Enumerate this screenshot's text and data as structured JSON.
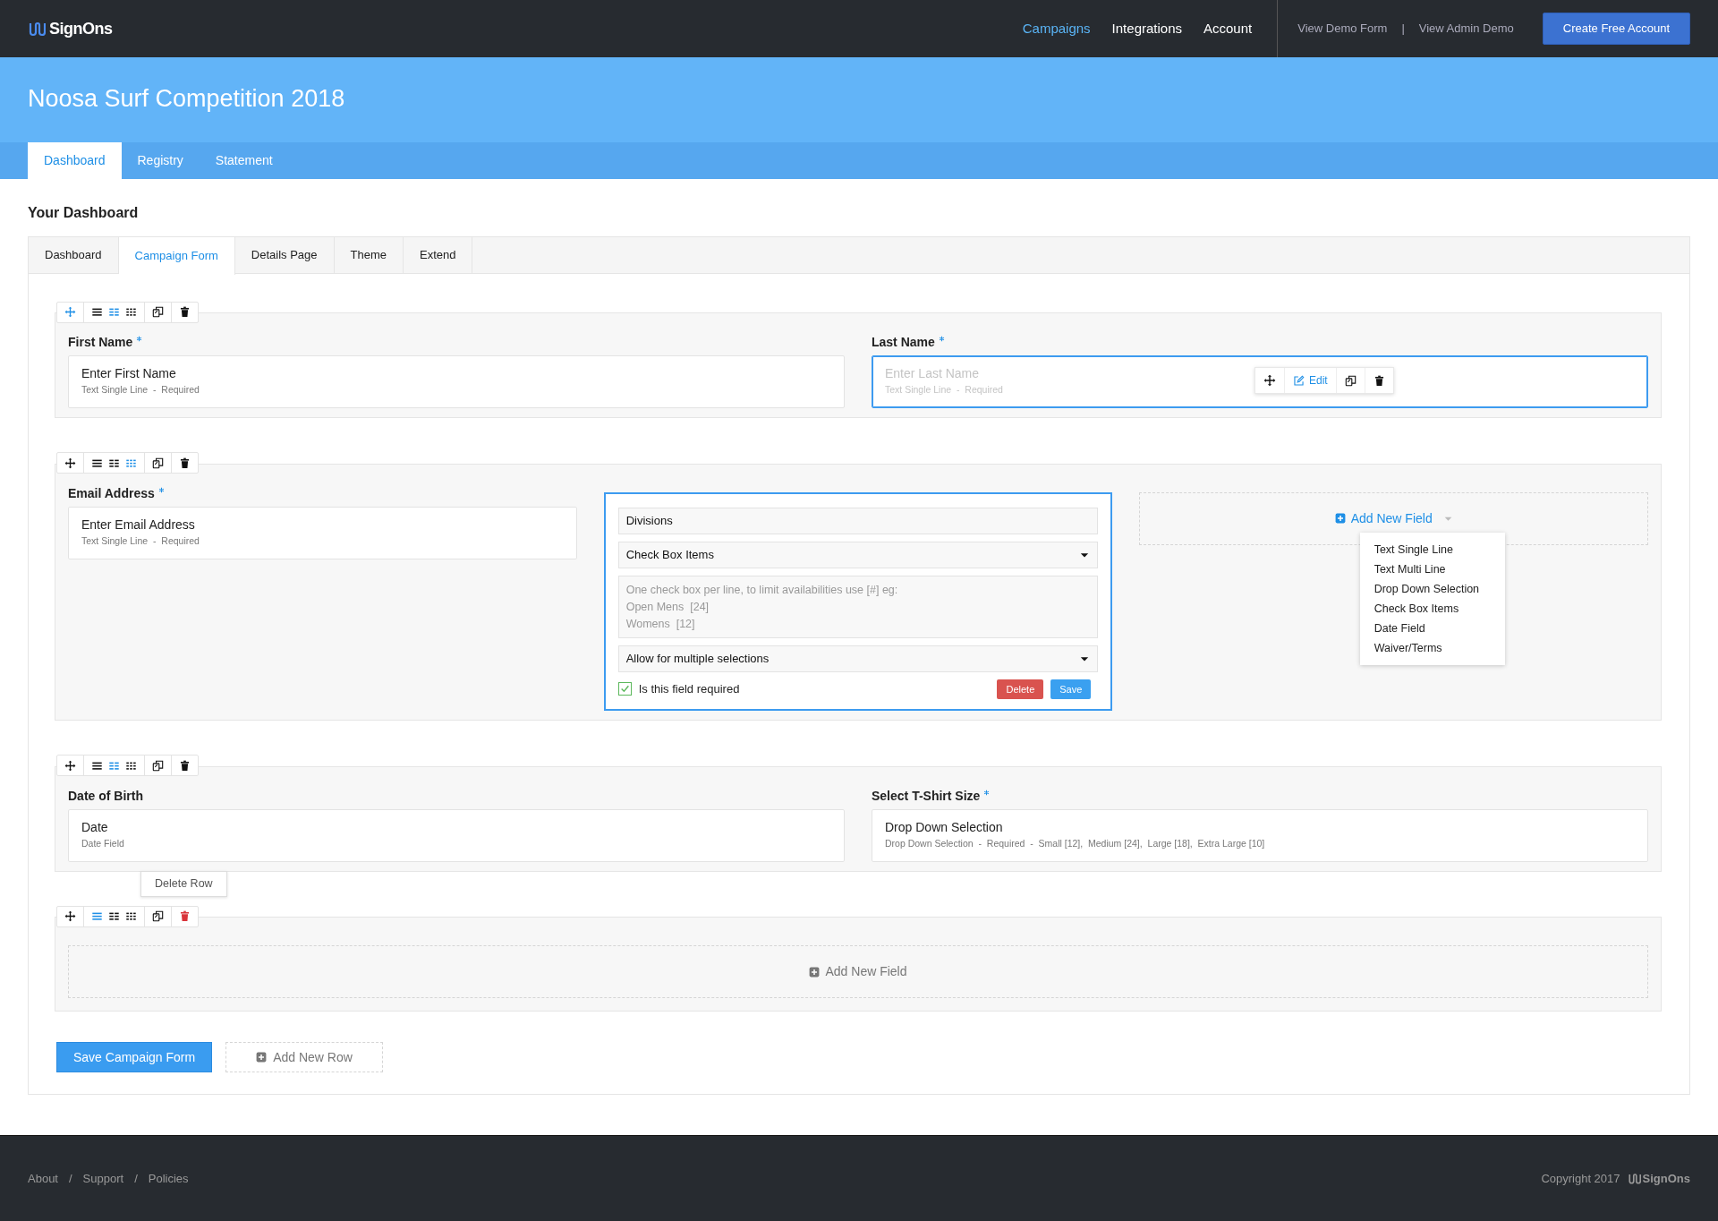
{
  "navbar": {
    "brand": "SignOns",
    "links": [
      {
        "label": "Campaigns",
        "selected": true
      },
      {
        "label": "Integrations",
        "selected": false
      },
      {
        "label": "Account",
        "selected": false
      }
    ],
    "demo_links": [
      "View Demo Form",
      "View Admin Demo"
    ],
    "demo_separator": "|",
    "cta": "Create Free Account"
  },
  "banner": {
    "title": "Noosa Surf Competition 2018",
    "tabs": [
      {
        "label": "Dashboard",
        "selected": true
      },
      {
        "label": "Registry",
        "selected": false
      },
      {
        "label": "Statement",
        "selected": false
      }
    ]
  },
  "heading": "Your Dashboard",
  "tabs": [
    {
      "label": "Dashboard",
      "selected": false
    },
    {
      "label": "Campaign Form",
      "selected": true
    },
    {
      "label": "Details Page",
      "selected": false
    },
    {
      "label": "Theme",
      "selected": false
    },
    {
      "label": "Extend",
      "selected": false
    }
  ],
  "rows": [
    {
      "layouts": [
        {
          "selected": false
        },
        {
          "selected": true
        },
        {
          "selected": false
        }
      ],
      "move_active": true,
      "delete_hover": false,
      "items": [
        {
          "kind": "field",
          "label": "First Name",
          "required": true,
          "title": "Enter First Name",
          "meta": "Text Single Line  -  Required",
          "selected": false
        },
        {
          "kind": "field",
          "label": "Last Name",
          "required": true,
          "title": "Enter Last Name",
          "meta": "Text Single Line  -  Required",
          "selected": true,
          "edit": "Edit"
        }
      ]
    },
    {
      "layouts": [
        {
          "selected": false
        },
        {
          "selected": false
        },
        {
          "selected": true
        }
      ],
      "move_active": false,
      "delete_hover": false,
      "items": [
        {
          "kind": "field",
          "label": "Email Address",
          "required": true,
          "title": "Enter Email Address",
          "meta": "Text Single Line  -  Required",
          "selected": false
        },
        {
          "kind": "editor",
          "name_value": "Divisions",
          "type_value": "Check Box Items",
          "options_placeholder": "One check box per line, to limit availabilities use [#] eg:\nOpen Mens  [24]\nWomens  [12]",
          "selection_value": "Allow for multiple selections",
          "required_label": "Is this field required",
          "required_checked": true,
          "delete": "Delete",
          "save": "Save"
        },
        {
          "kind": "add",
          "label": "Add New Field",
          "menu": [
            "Text Single Line",
            "Text Multi Line",
            "Drop Down Selection",
            "Check Box Items",
            "Date Field",
            "Waiver/Terms"
          ]
        }
      ]
    },
    {
      "layouts": [
        {
          "selected": false
        },
        {
          "selected": true
        },
        {
          "selected": false
        }
      ],
      "move_active": false,
      "delete_hover": false,
      "items": [
        {
          "kind": "field",
          "label": "Date of Birth",
          "required": false,
          "title": "Date",
          "meta": "Date Field",
          "selected": false
        },
        {
          "kind": "field",
          "label": "Select T-Shirt Size",
          "required": true,
          "title": "Drop Down Selection",
          "meta": "Drop Down Selection  -  Required  -  Small [12],  Medium [24],  Large [18],  Extra Large [10]",
          "selected": false
        }
      ]
    },
    {
      "layouts": [
        {
          "selected": true
        },
        {
          "selected": false
        },
        {
          "selected": false
        }
      ],
      "move_active": false,
      "delete_hover": true,
      "tooltip": "Delete Row",
      "items": [
        {
          "kind": "add",
          "label": "Add New Field"
        }
      ]
    }
  ],
  "actions": {
    "save": "Save Campaign Form",
    "add_row": "Add New Row"
  },
  "footer": {
    "items": [
      {
        "kind": "link",
        "text": "About"
      },
      {
        "kind": "sep",
        "text": "/"
      },
      {
        "kind": "link",
        "text": "Support"
      },
      {
        "kind": "sep",
        "text": "/"
      },
      {
        "kind": "link",
        "text": "Policies"
      }
    ],
    "copyright": "Copyright 2017",
    "brand": "SignOns"
  }
}
